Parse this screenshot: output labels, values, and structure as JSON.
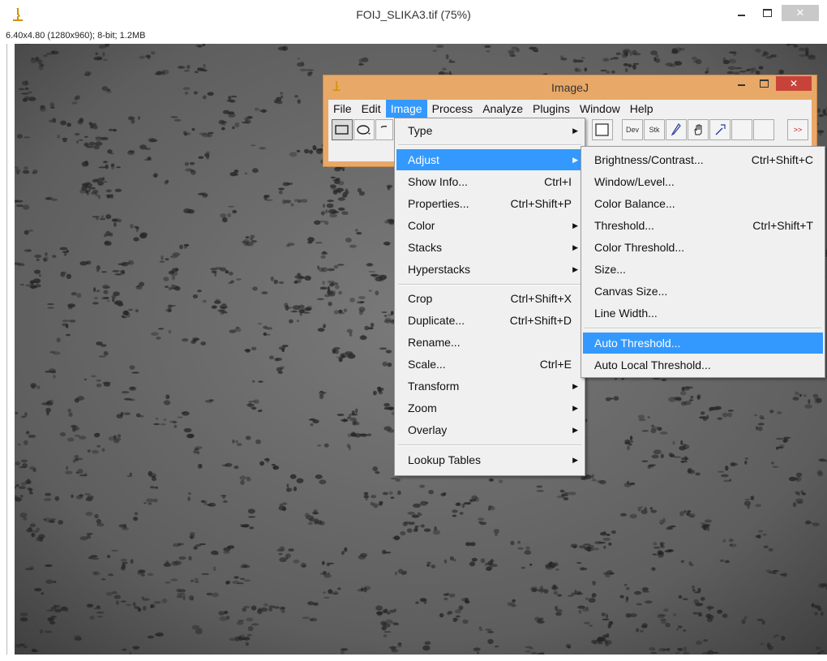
{
  "image_window": {
    "title": "FOIJ_SLIKA3.tif (75%)",
    "info": "6.40x4.80  (1280x960); 8-bit; 1.2MB",
    "controls": {
      "minimize": "–",
      "maximize": "",
      "close": "✕"
    }
  },
  "imagej_window": {
    "title": "ImageJ",
    "menubar": [
      "File",
      "Edit",
      "Image",
      "Process",
      "Analyze",
      "Plugins",
      "Window",
      "Help"
    ],
    "active_menu": "Image",
    "toolbar": {
      "tools": [
        "rectangle-tool",
        "oval-tool",
        "polygon-tool",
        "tool-blank",
        "dev-tool",
        "stk-tool",
        "pencil-tool",
        "hand-tool",
        "pointer-tool",
        "blank-tool",
        "more-tools"
      ],
      "dev_label": "Dev",
      "stk_label": "Stk",
      "more_label": ">>"
    }
  },
  "image_menu": {
    "items": [
      {
        "label": "Type",
        "shortcut": "",
        "submenu": true
      },
      {
        "label": "Adjust",
        "shortcut": "",
        "submenu": true,
        "highlighted": true
      },
      {
        "label": "Show Info...",
        "shortcut": "Ctrl+I",
        "submenu": false
      },
      {
        "label": "Properties...",
        "shortcut": "Ctrl+Shift+P",
        "submenu": false
      },
      {
        "label": "Color",
        "shortcut": "",
        "submenu": true
      },
      {
        "label": "Stacks",
        "shortcut": "",
        "submenu": true
      },
      {
        "label": "Hyperstacks",
        "shortcut": "",
        "submenu": true
      },
      {
        "label": "Crop",
        "shortcut": "Ctrl+Shift+X",
        "submenu": false
      },
      {
        "label": "Duplicate...",
        "shortcut": "Ctrl+Shift+D",
        "submenu": false
      },
      {
        "label": "Rename...",
        "shortcut": "",
        "submenu": false
      },
      {
        "label": "Scale...",
        "shortcut": "Ctrl+E",
        "submenu": false
      },
      {
        "label": "Transform",
        "shortcut": "",
        "submenu": true
      },
      {
        "label": "Zoom",
        "shortcut": "",
        "submenu": true
      },
      {
        "label": "Overlay",
        "shortcut": "",
        "submenu": true
      },
      {
        "label": "Lookup Tables",
        "shortcut": "",
        "submenu": true
      }
    ]
  },
  "adjust_submenu": {
    "items": [
      {
        "label": "Brightness/Contrast...",
        "shortcut": "Ctrl+Shift+C"
      },
      {
        "label": "Window/Level...",
        "shortcut": ""
      },
      {
        "label": "Color Balance...",
        "shortcut": ""
      },
      {
        "label": "Threshold...",
        "shortcut": "Ctrl+Shift+T"
      },
      {
        "label": "Color Threshold...",
        "shortcut": ""
      },
      {
        "label": "Size...",
        "shortcut": ""
      },
      {
        "label": "Canvas Size...",
        "shortcut": ""
      },
      {
        "label": "Line Width...",
        "shortcut": ""
      },
      {
        "label": "Auto Threshold...",
        "shortcut": "",
        "highlighted": true
      },
      {
        "label": "Auto Local Threshold...",
        "shortcut": ""
      }
    ]
  },
  "colors": {
    "highlight": "#3399ff",
    "imagej_frame": "#e8a868",
    "close_button": "#c7433a",
    "menu_bg": "#f0f0f0",
    "image_bg": "#5b5b5b",
    "specks": "#262626"
  }
}
